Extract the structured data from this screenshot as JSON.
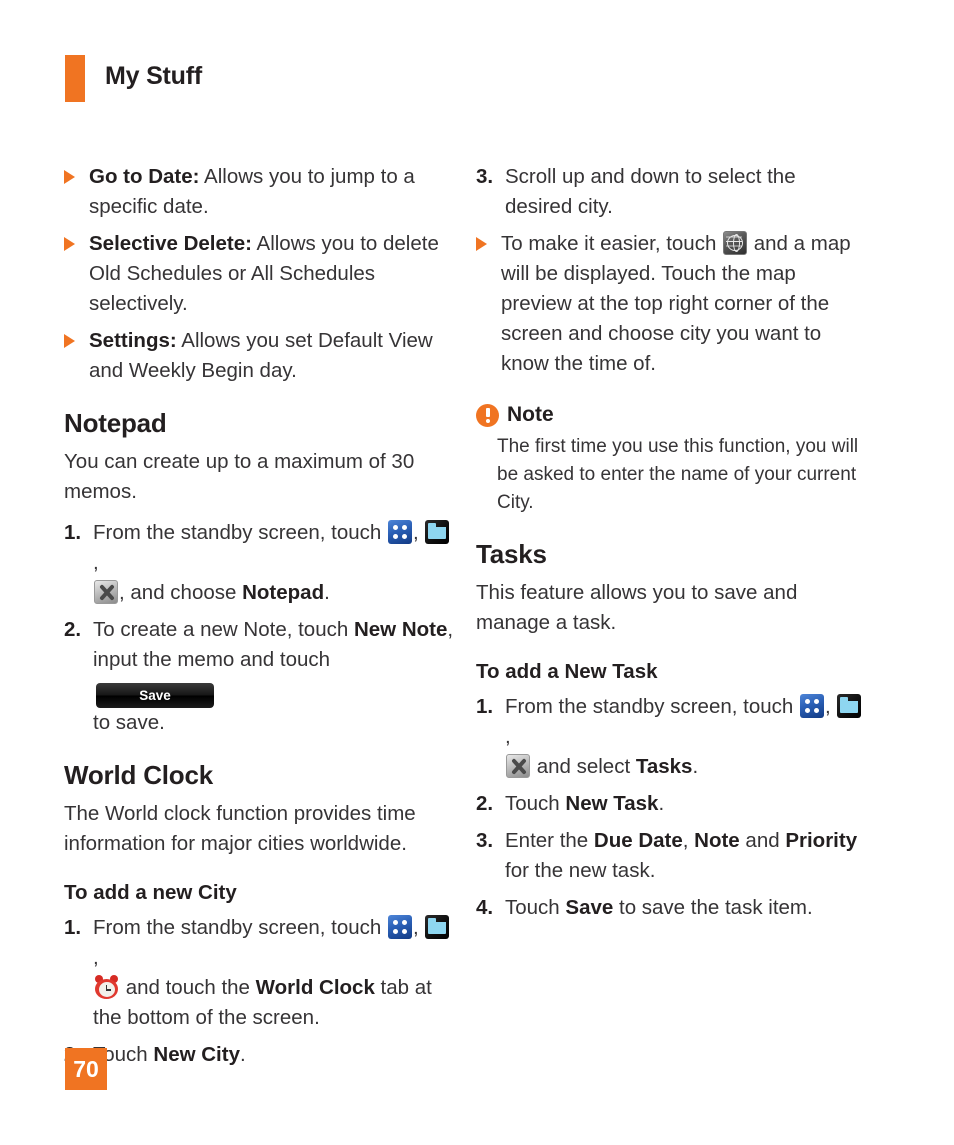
{
  "header": {
    "title": "My Stuff",
    "accent_color": "#F07422"
  },
  "left_column": {
    "bullets": [
      {
        "term": "Go to Date:",
        "text": " Allows you to jump to a specific date."
      },
      {
        "term": "Selective Delete:",
        "text": " Allows you to delete Old Schedules or All Schedules selectively."
      },
      {
        "term": "Settings:",
        "text": " Allows you set Default View and Weekly Begin day."
      }
    ],
    "notepad": {
      "heading": "Notepad",
      "intro": "You can create up to a maximum of 30 memos.",
      "step1": {
        "num": "1.",
        "part1": "From the standby screen, touch ",
        "sep1": ", ",
        "sep2": ", ",
        "part2": ", and choose ",
        "bold": "Notepad",
        "end": ".",
        "icons": [
          "grid-icon",
          "folder-icon",
          "tools-icon"
        ]
      },
      "step2": {
        "num": "2.",
        "part1": "To create a new Note, touch ",
        "bold1": "New Note",
        "part2": ", input the memo and touch ",
        "save_label": "Save",
        "part3": " to save."
      }
    },
    "world_clock": {
      "heading": "World Clock",
      "intro": "The World clock function provides time information for major cities worldwide.",
      "subheading": "To add a new City",
      "step1": {
        "num": "1.",
        "part1": "From the standby screen, touch ",
        "sep1": ", ",
        "sep2": ", ",
        "part2": " and touch the ",
        "bold": "World Clock",
        "part3": " tab at the bottom of the screen.",
        "icons": [
          "grid-icon",
          "folder-icon",
          "alarm-clock-icon"
        ]
      },
      "step2": {
        "num": "2.",
        "part1": "Touch ",
        "bold": "New City",
        "end": "."
      }
    }
  },
  "right_column": {
    "step3": {
      "num": "3.",
      "text": "Scroll up and down to select the desired city."
    },
    "bullet_map": {
      "part1": "To make it easier, touch ",
      "part2": " and a map will be displayed. Touch the map preview at the top right corner of the screen and choose city you want to know the time of.",
      "icon": "globe-icon"
    },
    "note": {
      "title": "Note",
      "body": "The first time you use this function, you will be asked to enter the name of your current City."
    },
    "tasks": {
      "heading": "Tasks",
      "intro": "This feature allows you to save and manage a task.",
      "subheading": "To add a New Task",
      "step1": {
        "num": "1.",
        "part1": "From the standby screen, touch ",
        "sep1": ", ",
        "sep2": ", ",
        "part2": " and select ",
        "bold": "Tasks",
        "end": ".",
        "icons": [
          "grid-icon",
          "folder-icon",
          "tools-icon"
        ]
      },
      "step2": {
        "num": "2.",
        "part1": "Touch ",
        "bold": "New Task",
        "end": "."
      },
      "step3": {
        "num": "3.",
        "part1": "Enter the ",
        "bold1": "Due Date",
        "sep1": ", ",
        "bold2": "Note",
        "sep2": " and ",
        "bold3": "Priority",
        "part2": " for the new task."
      },
      "step4": {
        "num": "4.",
        "part1": "Touch ",
        "bold": "Save",
        "part2": " to save the task item."
      }
    }
  },
  "footer": {
    "page_number": "70"
  }
}
